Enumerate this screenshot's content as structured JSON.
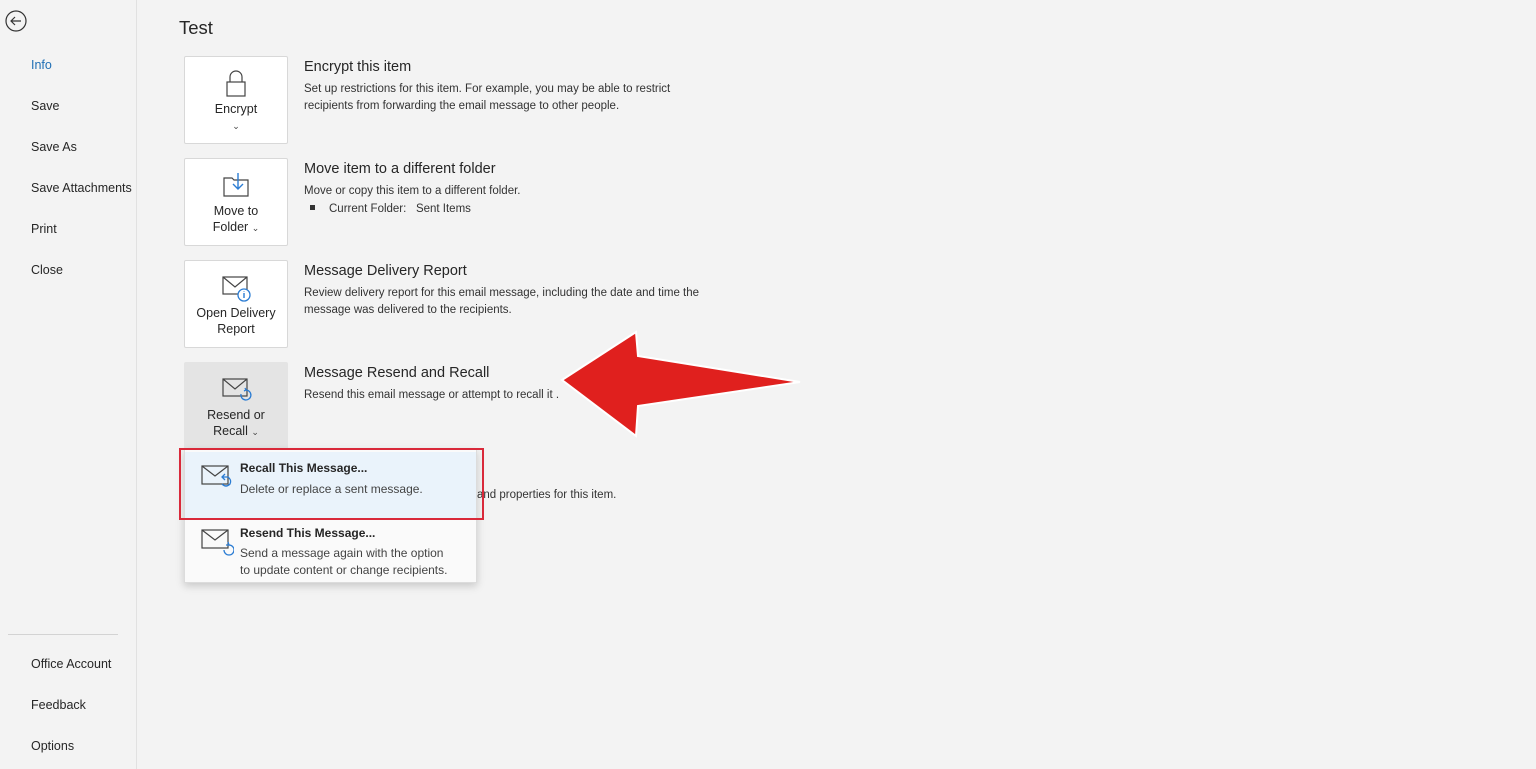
{
  "sidebar": {
    "items": [
      {
        "label": "Info",
        "active": true
      },
      {
        "label": "Save"
      },
      {
        "label": "Save As"
      },
      {
        "label": "Save Attachments"
      },
      {
        "label": "Print"
      },
      {
        "label": "Close"
      }
    ],
    "bottom_items": [
      {
        "label": "Office Account"
      },
      {
        "label": "Feedback"
      },
      {
        "label": "Options"
      }
    ]
  },
  "main": {
    "title": "Test",
    "encrypt": {
      "button_label": "Encrypt",
      "heading": "Encrypt this item",
      "description_line1": "Set up restrictions for this item. For example, you may be able to restrict",
      "description_line2": "recipients from forwarding the email message to other people."
    },
    "move": {
      "button_label_line1": "Move to",
      "button_label_line2": "Folder",
      "heading": "Move item to a different folder",
      "description": "Move or copy this item to a different folder.",
      "folder_label": "Current Folder:",
      "folder_value": "Sent Items"
    },
    "delivery": {
      "button_label_line1": "Open Delivery",
      "button_label_line2": "Report",
      "heading": "Message Delivery Report",
      "description_line1": "Review delivery report for this email message, including the date and time the",
      "description_line2": "message was delivered to the recipients."
    },
    "resend": {
      "button_label_line1": "Resend or",
      "button_label_line2": "Recall",
      "heading": "Message Resend and Recall",
      "description": "Resend this email message or attempt to recall it ."
    },
    "partial_desc": "and properties for this item."
  },
  "dropdown": {
    "recall": {
      "title": "Recall This Message...",
      "description": "Delete or replace a sent message."
    },
    "resend": {
      "title": "Resend This Message...",
      "description_line1": "Send a message again with the option",
      "description_line2": "to update content or change recipients."
    }
  },
  "colors": {
    "accent": "#1f6fb5",
    "highlight": "#d9293a",
    "arrow": "#e0201e"
  }
}
